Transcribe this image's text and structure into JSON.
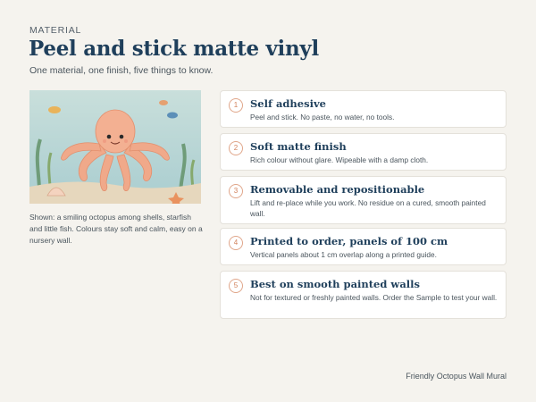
{
  "header": {
    "eyebrow": "MATERIAL",
    "title": "Peel and stick matte vinyl",
    "subtitle": "One material, one finish, five things to know."
  },
  "image": {
    "icon": "octopus-illustration",
    "caption": "Shown: a smiling octopus among shells, starfish and little fish. Colours stay soft and calm, easy on a nursery wall."
  },
  "features": [
    {
      "number": "1",
      "title": "Self adhesive",
      "text": "Peel and stick. No paste, no water, no tools."
    },
    {
      "number": "2",
      "title": "Soft matte finish",
      "text": "Rich colour without glare. Wipeable with a damp cloth."
    },
    {
      "number": "3",
      "title": "Removable and repositionable",
      "text": "Lift and re-place while you work. No residue on a cured, smooth painted wall."
    },
    {
      "number": "4",
      "title": "Printed to order, panels of 100 cm",
      "text": "Vertical panels about 1 cm overlap along a printed guide."
    },
    {
      "number": "5",
      "title": "Best on smooth painted walls",
      "text": "Not for textured or freshly painted walls. Order the Sample to test your wall."
    }
  ],
  "footer": {
    "product_name": "Friendly Octopus Wall Mural"
  },
  "colors": {
    "accent": "#1f3f5b",
    "number_accent": "#d2825c",
    "background": "#f5f3ee"
  }
}
